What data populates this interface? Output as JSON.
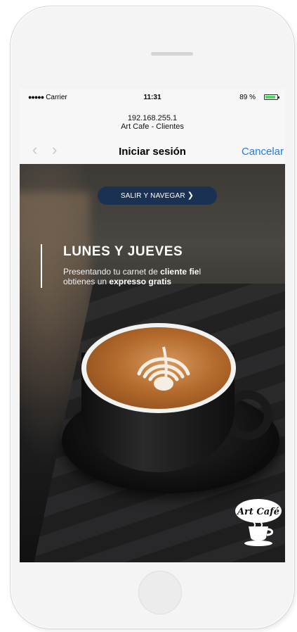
{
  "status_bar": {
    "signal": "●●●●●",
    "carrier": "Carrier",
    "time": "11:31",
    "battery_text": "89 %",
    "battery_level": 0.89,
    "battery_color": "#4cd964"
  },
  "address": {
    "ip": "192.168.255.1",
    "site_name": "Art Cafe - Clientes"
  },
  "navbar": {
    "back_icon": "chevron-left",
    "forward_icon": "chevron-right",
    "title": "Iniciar sesión",
    "cancel_label": "Cancelar",
    "accent_color": "#1a7ee8"
  },
  "hero": {
    "cta_label": "SALIR Y NAVEGAR",
    "cta_color": "#1b3152",
    "promo_title": "LUNES Y JUEVES",
    "promo_line1_pre": "Presentando tu carnet de ",
    "promo_line1_bold": "cliente fie",
    "promo_line1_post": "l",
    "promo_line2_pre": "obtienes un ",
    "promo_line2_bold": "expresso gratis",
    "logo_text": "Art Café"
  }
}
